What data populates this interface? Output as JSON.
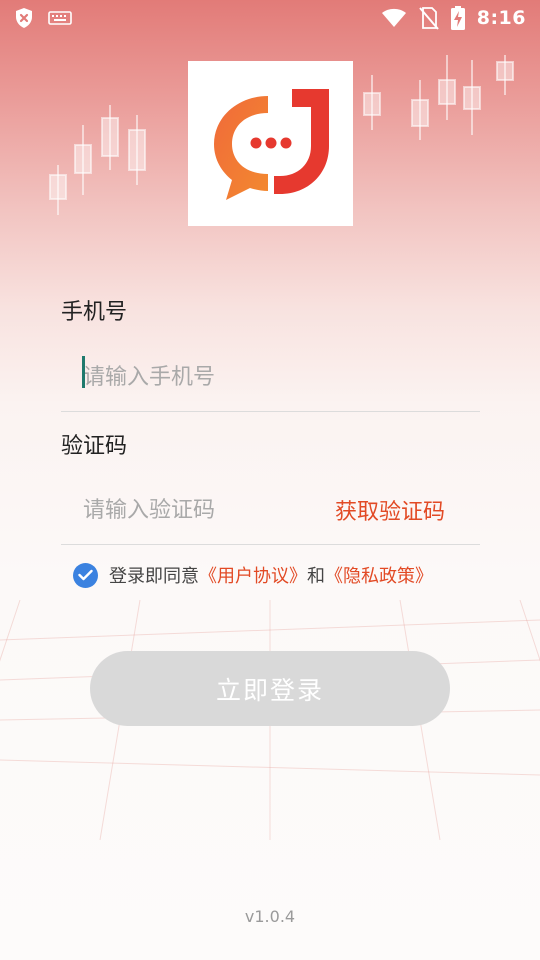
{
  "status_bar": {
    "time": "8:16",
    "icons": [
      "shield-x-icon",
      "keyboard-icon",
      "wifi-icon",
      "no-sim-icon",
      "battery-charging-icon"
    ]
  },
  "logo": {
    "name": "app-logo"
  },
  "form": {
    "phone": {
      "label": "手机号",
      "placeholder": "请输入手机号",
      "value": ""
    },
    "code": {
      "label": "验证码",
      "placeholder": "请输入验证码",
      "value": "",
      "get_code_label": "获取验证码"
    },
    "agreement": {
      "checked": true,
      "prefix": "登录即同意",
      "user_agreement": "《用户协议》",
      "and": "和",
      "privacy_policy": "《隐私政策》"
    },
    "submit_label": "立即登录"
  },
  "version": "v1.0.4",
  "colors": {
    "accent": "#e24a25",
    "checkbox": "#3b82e0",
    "button_disabled": "#d9d9d9",
    "header_top": "#e27b78"
  }
}
